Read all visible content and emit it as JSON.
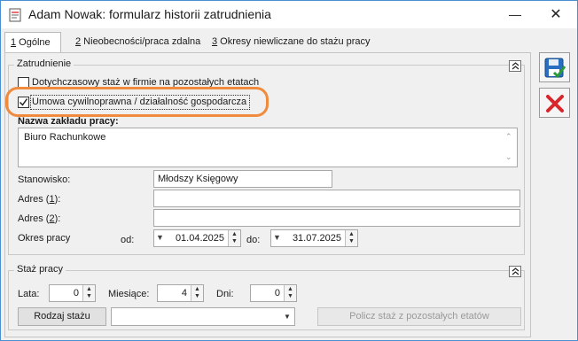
{
  "window": {
    "title": "Adam Nowak: formularz historii zatrudnienia",
    "minimize_glyph": "—",
    "close_glyph": "✕"
  },
  "tabs": [
    {
      "key": "1",
      "label": " Ogólne",
      "active": true
    },
    {
      "key": "2",
      "label": " Nieobecności/praca zdalna",
      "active": false
    },
    {
      "key": "3",
      "label": " Okresy niewliczane do stażu pracy",
      "active": false
    }
  ],
  "employment": {
    "group_label": "Zatrudnienie",
    "checkbox_previous_staz": {
      "label": "Dotychczasowy staż w firmie na pozostałych etatach",
      "checked": false
    },
    "checkbox_civil_contract": {
      "label": "Umowa cywilnoprawna / działalność gospodarcza",
      "checked": true
    },
    "workplace_label": "Nazwa zakładu pracy:",
    "workplace_value": "Biuro Rachunkowe",
    "position_label": "Stanowisko:",
    "position_value": "Młodszy Księgowy",
    "address1_label": "Adres (1):",
    "address1_value": "",
    "address2_label": "Adres (2):",
    "address2_value": "",
    "period_label": "Okres pracy",
    "from_label": "od:",
    "from_value": "01.04.2025",
    "to_label": "do:",
    "to_value": "31.07.2025"
  },
  "seniority": {
    "group_label": "Staż pracy",
    "years_label": "Lata:",
    "years_value": "0",
    "months_label": "Miesiące:",
    "months_value": "4",
    "days_label": "Dni:",
    "days_value": "0",
    "type_button": "Rodzaj stażu",
    "type_value": "",
    "calc_button": "Policz staż z pozostałych etatów"
  },
  "colors": {
    "accent_border": "#4a8fd1",
    "highlight_ring": "#f08a3c",
    "save_icon": "#1f5fa8",
    "cancel_icon": "#d8262c"
  },
  "icons": {
    "save": "floppy-save-icon",
    "cancel": "red-x-icon",
    "collapse": "chevron-up-double-icon"
  }
}
